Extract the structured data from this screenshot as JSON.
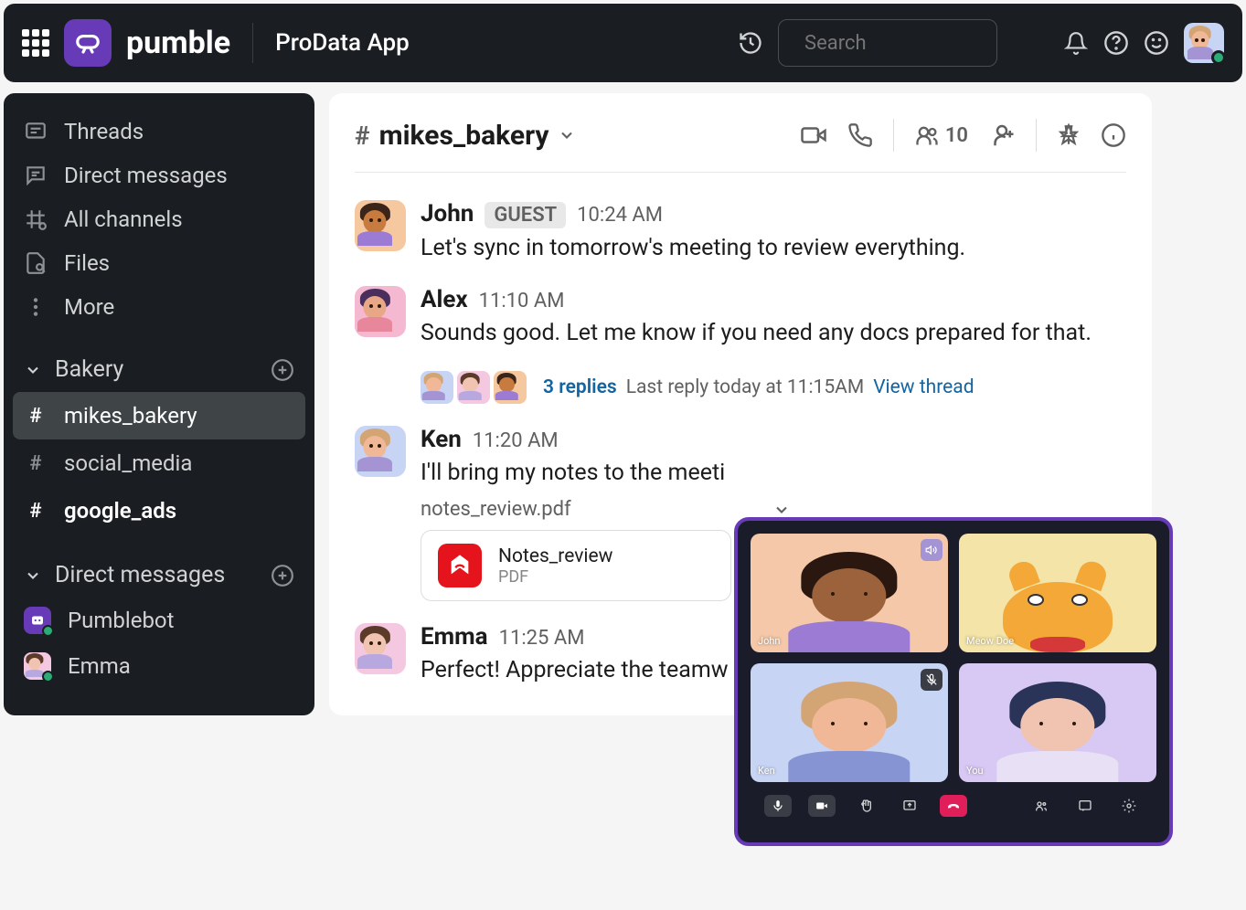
{
  "header": {
    "brand": "pumble",
    "workspace": "ProData App",
    "search_placeholder": "Search"
  },
  "sidebar": {
    "nav": [
      {
        "label": "Threads",
        "icon": "threads-icon"
      },
      {
        "label": "Direct messages",
        "icon": "dm-icon"
      },
      {
        "label": "All channels",
        "icon": "channels-icon"
      },
      {
        "label": "Files",
        "icon": "files-icon"
      },
      {
        "label": "More",
        "icon": "more-icon"
      }
    ],
    "sections": {
      "bakery": {
        "label": "Bakery",
        "channels": [
          {
            "name": "mikes_bakery",
            "active": true
          },
          {
            "name": "social_media",
            "active": false
          },
          {
            "name": "google_ads",
            "active": false,
            "bold": true
          }
        ]
      },
      "dm": {
        "label": "Direct messages",
        "items": [
          {
            "name": "Pumblebot"
          },
          {
            "name": "Emma"
          }
        ]
      }
    }
  },
  "channel": {
    "name": "mikes_bakery",
    "member_count": "10"
  },
  "messages": [
    {
      "author": "John",
      "badge": "GUEST",
      "time": "10:24 AM",
      "text": "Let's sync in tomorrow's meeting to review everything.",
      "avatar_bg": "#f6c8a0",
      "skin": "#c77b3f",
      "hair": "#3a2518",
      "shirt": "#9b7bd4"
    },
    {
      "author": "Alex",
      "time": "11:10 AM",
      "text": "Sounds good. Let me know if you need any docs prepared for that.",
      "avatar_bg": "#f4b8d0",
      "skin": "#e8a888",
      "hair": "#4a2f5c",
      "shirt": "#e8869b",
      "thread": {
        "count": "3 replies",
        "last": "Last reply today at 11:15AM",
        "view": "View thread"
      }
    },
    {
      "author": "Ken",
      "time": "11:20 AM",
      "text": "I'll bring my notes to the meeti",
      "avatar_bg": "#c8d4f4",
      "skin": "#f0b896",
      "hair": "#d4a574",
      "shirt": "#a594d4",
      "attachment": {
        "filename": "notes_review.pdf",
        "title": "Notes_review",
        "type": "PDF"
      }
    },
    {
      "author": "Emma",
      "time": "11:25 AM",
      "text": "Perfect! Appreciate the teamw",
      "avatar_bg": "#f4c8e0",
      "skin": "#f0c4b0",
      "hair": "#5c3a2a",
      "shirt": "#b8a8e0"
    }
  ],
  "call": {
    "tiles": [
      {
        "name": "John",
        "bg": "#f4c8a8",
        "skin": "#9b623b",
        "hair": "#2a1810",
        "shirt": "#9b7bd4",
        "speaker": true
      },
      {
        "name": "Meow Doe",
        "bg": "#f4e4a8",
        "cat": true
      },
      {
        "name": "Ken",
        "bg": "#c8d4f4",
        "skin": "#f0b896",
        "hair": "#d4a574",
        "shirt": "#8694d4",
        "muted": true
      },
      {
        "name": "You",
        "bg": "#d8c8f4",
        "skin": "#f0c4b0",
        "hair": "#2a3458",
        "shirt": "#e8e0f4"
      }
    ]
  }
}
